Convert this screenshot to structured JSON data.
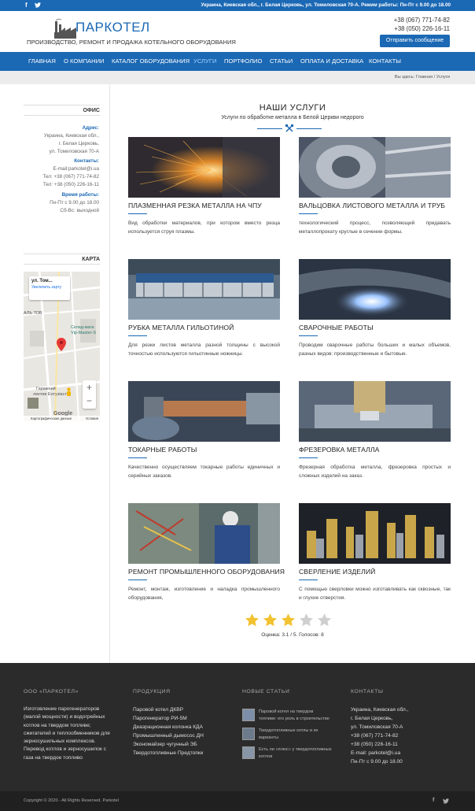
{
  "topbar": {
    "facebook_icon": "f",
    "twitter_icon": "twitter-bird",
    "info": "Украина, Киевская обл., г. Белая Церковь, ул. Томиловская 70-А. Режим работы: Пн-Пт с 9.00 до 18.00"
  },
  "header": {
    "brand": "ПАРКОТЕЛ",
    "tagline": "ПРОИЗВОДСТВО, РЕМОНТ И ПРОДАЖА КОТЕЛЬНОГО ОБОРУДОВАНИЯ",
    "phone1": "+38 (067) 771-74-82",
    "phone2": "+38 (050) 226-16-11",
    "message_button": "Отправить сообщение"
  },
  "nav": {
    "items": [
      "ГЛАВНАЯ",
      "О КОМПАНИИ",
      "КАТАЛОГ ОБОРУДОВАНИЯ",
      "УСЛУГИ",
      "ПОРТФОЛИО",
      "СТАТЬИ",
      "ОПЛАТА И ДОСТАВКА",
      "КОНТАКТЫ"
    ],
    "active": "УСЛУГИ"
  },
  "breadcrumb": {
    "prefix": "Вы здесь:",
    "home": "Главная",
    "sep": "/",
    "current": "Услуги"
  },
  "sidebar": {
    "office_title": "ОФИС",
    "address_label": "Адрес:",
    "address_lines": [
      "Украина, Киевская обл.,",
      "г. Белая Церковь,",
      "ул. Томиловская 70-А"
    ],
    "contacts_label": "Контакты:",
    "contacts_lines": [
      "E-mail:parkotel@i.ua",
      "Тел: +38 (067) 771-74-82",
      "Тел: +38 (050) 226-16-11"
    ],
    "hours_label": "Время работы:",
    "hours_lines": [
      "Пн-Пт с 9.00 до 18.00",
      "Сб-Вс: выходной"
    ],
    "map_title": "КАРТА",
    "map": {
      "popup_title": "ул. Том...",
      "popup_link": "Увеличить карту",
      "label1": "АЛЬ ТОВ",
      "label2": "Склад-мага",
      "label3": "Vip-Master-S",
      "label4": "Гаражний",
      "label5": "лектив Ентузіаст",
      "brand": "Google",
      "footer_left": "Картографические данные",
      "footer_right": "Условия",
      "zoom_in": "+",
      "zoom_out": "−"
    }
  },
  "main": {
    "title": "НАШИ УСЛУГИ",
    "subtitle": "Услуги по обработке металла в Белой Церкви недорого",
    "services": [
      {
        "title": "ПЛАЗМЕННАЯ РЕЗКА МЕТАЛЛА НА ЧПУ",
        "desc": "Вид обработки материалов, при котором вместо резца используется струя плазмы."
      },
      {
        "title": "ВАЛЬЦОВКА ЛИСТОВОГО МЕТАЛЛА И ТРУБ",
        "desc": "технологический процесс, позволяющий придавать металлопрокату круглые в сечении формы."
      },
      {
        "title": "РУБКА МЕТАЛЛА ГИЛЬОТИНОЙ",
        "desc": "Для резки листов металла разной толщины с высокой точностью используются гильотинные ножницы."
      },
      {
        "title": "СВАРОЧНЫЕ РАБОТЫ",
        "desc": "Проводим сварочные работы больших и малых объемов, разных видов: производственные и бытовые."
      },
      {
        "title": "ТОКАРНЫЕ РАБОТЫ",
        "desc": "Качественно осуществляем токарные работы единичных и серийных заказов."
      },
      {
        "title": "ФРЕЗЕРОВКА МЕТАЛЛА",
        "desc": "Фрезерная обработка металла, фрезеровка простых и сложных изделий на заказ."
      },
      {
        "title": "РЕМОНТ ПРОМЫШЛЕННОГО ОБОРУДОВАНИЯ",
        "desc": "Ремонт, монтаж, изготовление и наладка промышленного оборудования,"
      },
      {
        "title": "СВЕРЛЕНИЕ ИЗДЕЛИЙ",
        "desc": "С помощью сверловки можно изготавливать как сквозные, так и глухие отверстия."
      }
    ],
    "rating": {
      "value": 3.1,
      "max": 5,
      "filled_color": "#f2c230",
      "empty_color": "#cfcfcf",
      "text": "Оценка: 3.1 / 5. Голосов: 8"
    }
  },
  "footer": {
    "col1": {
      "title": "ООО «ПАРКОТЕЛ»",
      "lines": [
        "Изготовление парогенераторов",
        "(малой мощности) и водогрейных",
        "котлов на твердом топливе;",
        "сжигателей и теплообменников для",
        "зерносушильных комплексов.",
        "Перевод котлов и зерносушилок с",
        "газа на твердое топливо"
      ]
    },
    "col2": {
      "title": "ПРОДУКЦИЯ",
      "lines": [
        "Паровой котел ДКВР",
        "Парогенератор РИ-5М",
        "Деаэрационная колонка КДА",
        "Промышленный дымосос ДН",
        "Экономайзер чугунный ЭБ",
        "Твердотопливные Предтопки"
      ]
    },
    "col3": {
      "title": "НОВЫЕ СТАТЬИ",
      "articles": [
        {
          "lines": [
            "Паровой котел на твердом",
            "топливе: его роль в строительстве"
          ]
        },
        {
          "lines": [
            "Твердотопливные котлы и их",
            "варианты"
          ]
        },
        {
          "lines": [
            "Есть ли «плюс» у твердотопливных",
            "котлов"
          ]
        }
      ]
    },
    "col4": {
      "title": "КОНТАКТЫ",
      "lines": [
        "Украина, Киевская обл.,",
        "г. Белая Церковь,",
        "ул. Томиловская 70-А",
        "+38 (067) 771-74-82",
        "+38 (050) 226-16-11",
        "E-mail: parkotel@i.ua",
        "Пн-Пт с 9.00 до 18.00"
      ]
    },
    "copyright": "Copyright © 2020 - All Rights Reserved. Parkotel"
  },
  "colors": {
    "brand_blue": "#1b68b4",
    "footer_dark": "#2b2b2b",
    "bottom_dark": "#202020"
  }
}
